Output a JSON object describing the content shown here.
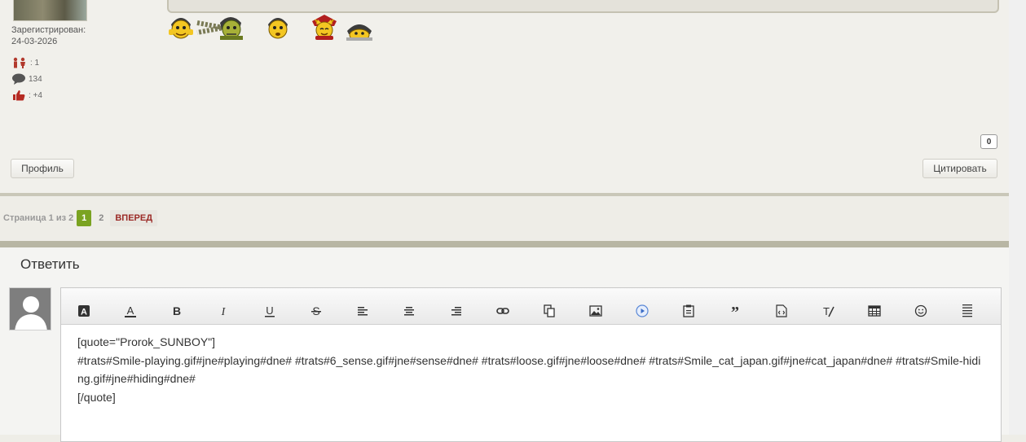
{
  "author": {
    "registered_label": "Зарегистрирован:",
    "registered_date": "24-03-2026",
    "stats": [
      {
        "icon": "people-icon",
        "value": ": 1"
      },
      {
        "icon": "speech-bubble-icon",
        "value": "134"
      },
      {
        "icon": "thumbs-up-icon",
        "value": ": +4"
      }
    ]
  },
  "post": {
    "smileys": [
      "playing",
      "6_sense",
      "loose",
      "cat_japan",
      "hiding"
    ],
    "like_count": "0",
    "profile_label": "Профиль",
    "quote_label": "Цитировать"
  },
  "pagination": {
    "label": "Страница 1 из 2",
    "current": "1",
    "next_page": "2",
    "next_label": "ВПЕРЕД"
  },
  "reply": {
    "title": "Ответить",
    "toolbar": [
      "font-icon",
      "font-color-icon",
      "bold-icon",
      "italic-icon",
      "underline-icon",
      "strikethrough-icon",
      "align-left-icon",
      "align-center-icon",
      "align-right-icon",
      "link-icon",
      "copy-icon",
      "image-icon",
      "video-icon",
      "paste-icon",
      "quote-icon",
      "code-icon",
      "clear-format-icon",
      "table-icon",
      "smiley-icon",
      "more-icon"
    ],
    "text": "[quote=\"Prorok_SUNBOY\"]\n#trats#Smile-playing.gif#jne#playing#dne# #trats#6_sense.gif#jne#sense#dne# #trats#loose.gif#jne#loose#dne# #trats#Smile_cat_japan.gif#jne#cat_japan#dne# #trats#Smile-hiding.gif#jne#hiding#dne#\n[/quote]"
  },
  "colors": {
    "accent": "#7aa321",
    "next_text": "#9b2a26",
    "divider": "#b8b6a4"
  }
}
